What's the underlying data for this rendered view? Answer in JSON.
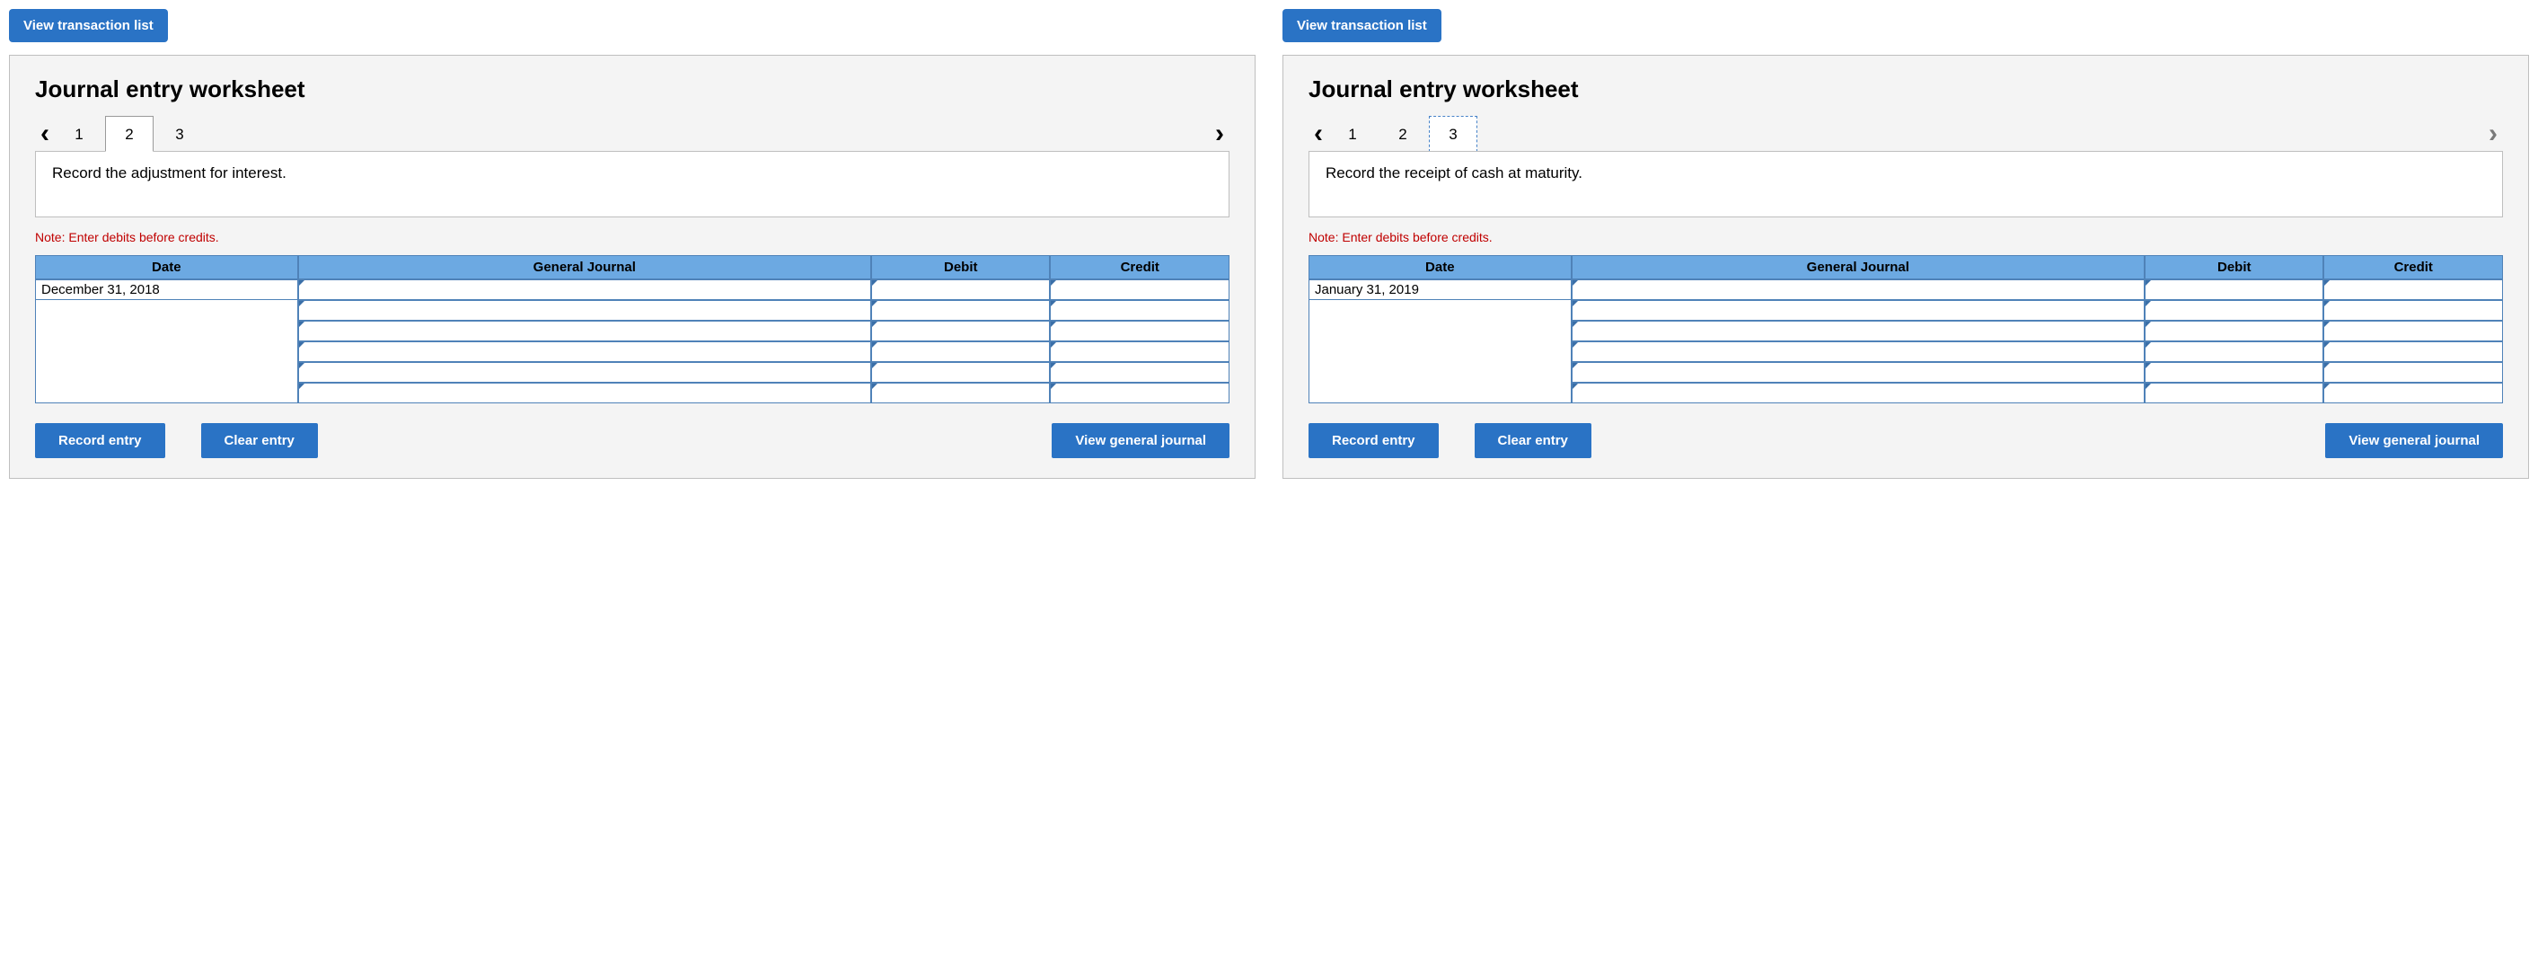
{
  "panels": [
    {
      "view_tx_label": "View transaction list",
      "title": "Journal entry worksheet",
      "tabs": [
        "1",
        "2",
        "3"
      ],
      "active_tab": "2",
      "active_style": "solid",
      "left_arrow": "‹",
      "right_arrow": "›",
      "right_arrow_dark": true,
      "prompt": "Record the adjustment for interest.",
      "note": "Note: Enter debits before credits.",
      "columns": {
        "date": "Date",
        "gj": "General Journal",
        "debit": "Debit",
        "credit": "Credit"
      },
      "rows": [
        {
          "date": "December 31, 2018",
          "gj": "",
          "debit": "",
          "credit": ""
        },
        {
          "date": "",
          "gj": "",
          "debit": "",
          "credit": ""
        },
        {
          "date": "",
          "gj": "",
          "debit": "",
          "credit": ""
        },
        {
          "date": "",
          "gj": "",
          "debit": "",
          "credit": ""
        },
        {
          "date": "",
          "gj": "",
          "debit": "",
          "credit": ""
        },
        {
          "date": "",
          "gj": "",
          "debit": "",
          "credit": ""
        }
      ],
      "buttons": {
        "record": "Record entry",
        "clear": "Clear entry",
        "view_gj": "View general journal"
      }
    },
    {
      "view_tx_label": "View transaction list",
      "title": "Journal entry worksheet",
      "tabs": [
        "1",
        "2",
        "3"
      ],
      "active_tab": "3",
      "active_style": "dashed",
      "left_arrow": "‹",
      "right_arrow": "›",
      "right_arrow_dark": false,
      "prompt": "Record the receipt of cash at maturity.",
      "note": "Note: Enter debits before credits.",
      "columns": {
        "date": "Date",
        "gj": "General Journal",
        "debit": "Debit",
        "credit": "Credit"
      },
      "rows": [
        {
          "date": "January 31, 2019",
          "gj": "",
          "debit": "",
          "credit": ""
        },
        {
          "date": "",
          "gj": "",
          "debit": "",
          "credit": ""
        },
        {
          "date": "",
          "gj": "",
          "debit": "",
          "credit": ""
        },
        {
          "date": "",
          "gj": "",
          "debit": "",
          "credit": ""
        },
        {
          "date": "",
          "gj": "",
          "debit": "",
          "credit": ""
        },
        {
          "date": "",
          "gj": "",
          "debit": "",
          "credit": ""
        }
      ],
      "buttons": {
        "record": "Record entry",
        "clear": "Clear entry",
        "view_gj": "View general journal"
      }
    }
  ]
}
